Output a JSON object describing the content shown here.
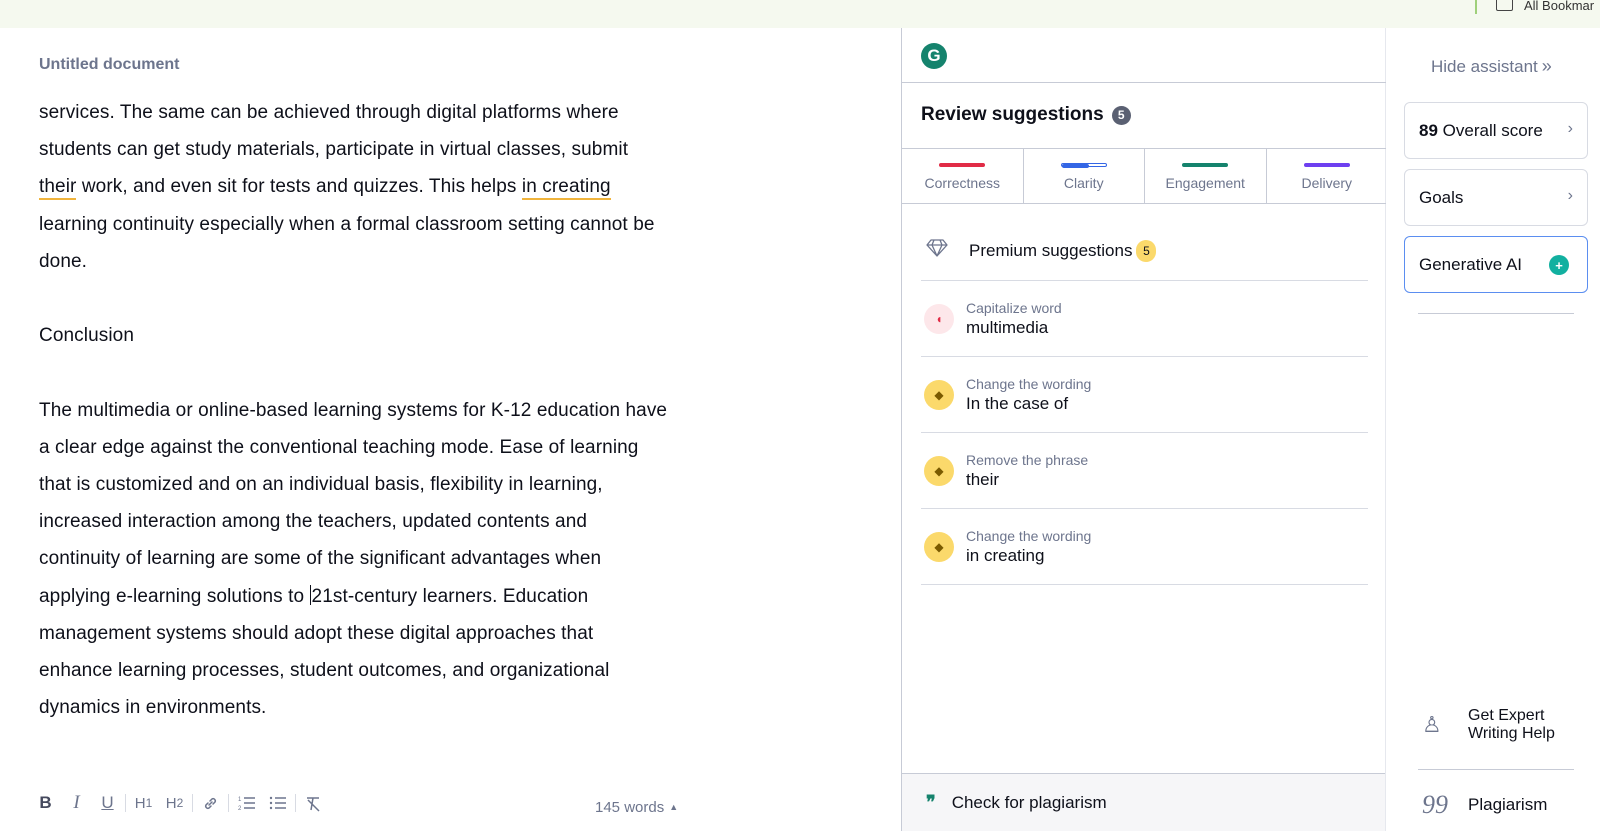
{
  "browser": {
    "bookmarks_label": "All Bookmar"
  },
  "editor": {
    "title": "Untitled document",
    "paragraph1": {
      "l1": "services. The same can be achieved through digital platforms where",
      "l2": "students can get study materials, participate in virtual classes, submit",
      "l3_flag1": "their",
      "l3_mid": " work, and even sit for tests and quizzes. This helps ",
      "l3_flag2": "in creating",
      "l4": "learning continuity especially when a formal classroom setting cannot be",
      "l5": "done."
    },
    "heading": "Conclusion",
    "paragraph2": {
      "l1": "The multimedia or online-based learning systems for K-12 education have",
      "l2": "a clear edge against the conventional teaching mode. Ease of learning",
      "l3": "that is customized and on an individual basis, flexibility in learning,",
      "l4": "increased interaction among the teachers, updated contents and",
      "l5": "continuity of learning are some of the significant advantages when",
      "l6a": "applying e-learning solutions to ",
      "l6b": "21st-century learners. Education",
      "l7": "management systems should adopt these digital approaches that",
      "l8": "enhance learning processes, student outcomes, and organizational",
      "l9": "dynamics in environments."
    },
    "toolbar": {
      "bold": "B",
      "italic": "I",
      "underline": "U",
      "h1": "H",
      "h1_sub": "1",
      "h2": "H",
      "h2_sub": "2",
      "link": "🔗",
      "ol": "⒈",
      "ul": "☰",
      "clear": "T̸"
    },
    "word_count": "145 words",
    "word_count_arrow": "▲"
  },
  "assistant": {
    "logo": "G",
    "review_title": "Review suggestions",
    "review_count": "5",
    "categories": [
      {
        "label": "Correctness",
        "color": "#e12b46",
        "fill": 1.0
      },
      {
        "label": "Clarity",
        "color": "#3466e5",
        "fill": 0.62
      },
      {
        "label": "Engagement",
        "color": "#15836d",
        "fill": 1.0
      },
      {
        "label": "Delivery",
        "color": "#6e3ff0",
        "fill": 1.0
      }
    ],
    "premium_label": "Premium suggestions",
    "premium_count": "5",
    "premium_icon": "diamond-icon",
    "suggestions": [
      {
        "type": "Capitalize word",
        "word": "multimedia",
        "icon": "correctness-shield-icon",
        "glyph": "◖"
      },
      {
        "type": "Change the wording",
        "word": "In the case of",
        "icon": "premium-gem-icon",
        "glyph": "◆"
      },
      {
        "type": "Remove the phrase",
        "word": "their",
        "icon": "premium-gem-icon",
        "glyph": "◆"
      },
      {
        "type": "Change the wording",
        "word": "in creating",
        "icon": "premium-gem-icon",
        "glyph": "◆"
      }
    ],
    "plagiarism_button": "Check for plagiarism",
    "plagiarism_glyph": "❞"
  },
  "side": {
    "hide_label": "Hide assistant",
    "hide_chevron": "»",
    "score_value": "89",
    "score_label": "Overall score",
    "goals_label": "Goals",
    "gen_ai_label": "Generative AI",
    "gen_ai_glyph": "+",
    "arrow": "›",
    "expert_label": "Get Expert Writing Help",
    "expert_glyph": "♙",
    "plagiarism_label": "Plagiarism",
    "plagiarism_glyph": "99"
  }
}
